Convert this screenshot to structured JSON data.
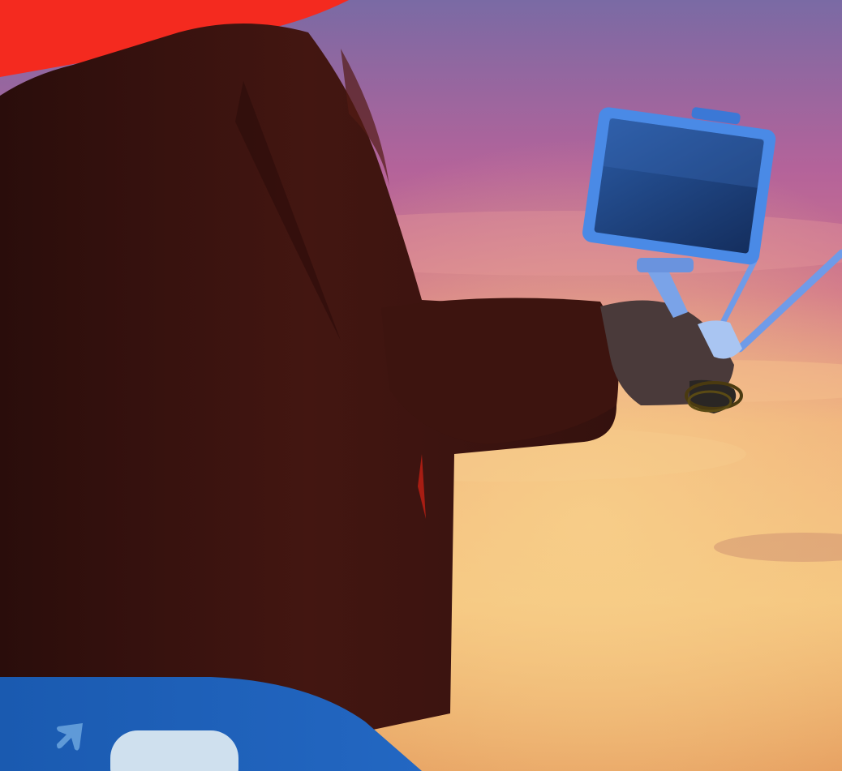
{
  "photo": {
    "subject": "drone-pilot-with-controller",
    "colors": {
      "sky_top": "#7a6aa4",
      "sky_mid": "#c7708e",
      "sky_bottom": "#f2c07c",
      "jacket": "#3a120e",
      "tablet_frame": "#4a8ae6",
      "tablet_screen": "#1b3f7a"
    }
  },
  "brand": {
    "accent_red": "#f42a1f",
    "accent_blue": "#1d63b9",
    "panel_light": "#cfe0ee",
    "arrow_icon": "arrow-up-right-icon"
  }
}
